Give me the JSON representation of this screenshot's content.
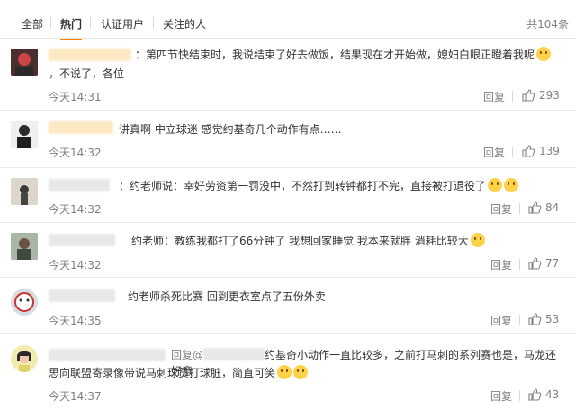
{
  "tabs": [
    {
      "label": "全部"
    },
    {
      "label": "热门"
    },
    {
      "label": "认证用户"
    },
    {
      "label": "关注的人"
    }
  ],
  "total": "共104条",
  "comments": [
    {
      "text": "：第四节快结束时，我说结束了好去做饭，结果现在才开始做，媳妇白眼正瞪着我呢",
      "text2": "，不说了，各位",
      "time": "今天14:31",
      "reply": "回复",
      "likes": "293",
      "emoji": "smirk-emoji"
    },
    {
      "text": "讲真啊 中立球迷 感觉约基奇几个动作有点……",
      "time": "今天14:32",
      "reply": "回复",
      "likes": "139"
    },
    {
      "text": "：约老师说：幸好劳资第一罚没中，不然打到转钟都打不完，直接被打退役了",
      "time": "今天14:32",
      "reply": "回复",
      "likes": "84",
      "emoji": "laugh-emoji"
    },
    {
      "text": "约老师：教练我都打了66分钟了 我想回家睡觉 我本来就胖 消耗比较大",
      "time": "今天14:32",
      "reply": "回复",
      "likes": "77",
      "emoji": "tired-emoji"
    },
    {
      "text": "约老师杀死比赛 回到更衣室点了五份外卖",
      "time": "今天14:35",
      "reply": "回复",
      "likes": "53"
    },
    {
      "prefix": "回复@",
      "text": "约基奇小动作一直比较多，之前打马刺的系列赛也是，马龙还好意",
      "text2": "思向联盟寄录像带说马刺球员打球脏，简直可笑",
      "time": "今天14:37",
      "reply": "回复",
      "likes": "43",
      "emoji": "mock-emoji"
    }
  ]
}
